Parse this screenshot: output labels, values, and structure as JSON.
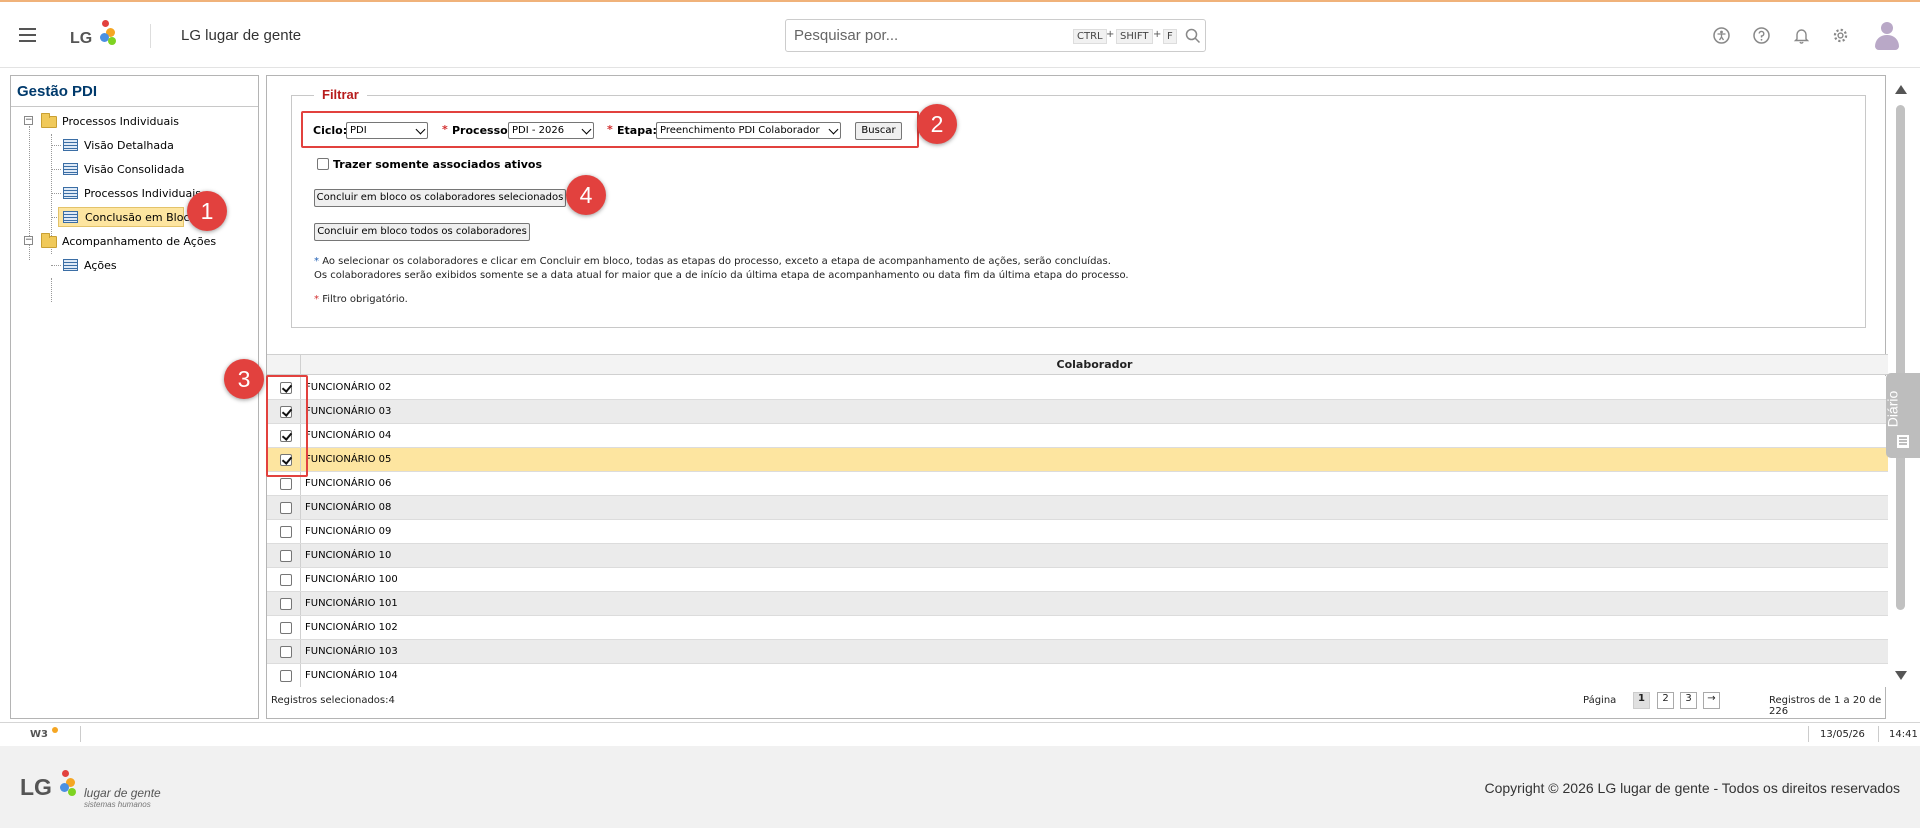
{
  "header": {
    "app_title": "LG lugar de gente",
    "search_placeholder": "Pesquisar por...",
    "shortcut_keys": [
      "CTRL",
      "SHIFT",
      "F"
    ],
    "shortcut_sep": "+"
  },
  "logo_text": "LG",
  "tree": {
    "title": "Gestão PDI",
    "groups": [
      {
        "label": "Processos Individuais",
        "children": [
          "Visão Detalhada",
          "Visão Consolidada",
          "Processos Individuais",
          "Conclusão em Bloco"
        ]
      },
      {
        "label": "Acompanhamento de Ações",
        "children": [
          "Ações"
        ]
      }
    ],
    "selected": "Conclusão em Bloco",
    "expander_glyph": "−"
  },
  "filter": {
    "legend": "Filtrar",
    "required_mark": "*",
    "ciclo_label": "Ciclo:",
    "ciclo_value": "PDI",
    "processo_label": "Processo:",
    "processo_value": "PDI - 2026",
    "etapa_label": "Etapa:",
    "etapa_value": "Preenchimento PDI Colaborador",
    "buscar_label": "Buscar",
    "ativos_label": "Trazer somente associados ativos",
    "ativos_checked": false,
    "btn_selecionados": "Concluir em bloco os colaboradores selecionados",
    "btn_todos": "Concluir em bloco todos os colaboradores",
    "note1": "Ao selecionar os colaboradores e clicar em Concluir em bloco, todas as etapas do processo, exceto a etapa de acompanhamento de ações, serão concluídas.",
    "note2": "Os colaboradores serão exibidos somente se a data atual for maior que a de início da última etapa de acompanhamento ou data fim da última etapa do processo.",
    "note3": "Filtro obrigatório."
  },
  "grid": {
    "column_header": "Colaborador",
    "rows": [
      {
        "name": "FUNCIONÁRIO 02",
        "checked": true
      },
      {
        "name": "FUNCIONÁRIO 03",
        "checked": true
      },
      {
        "name": "FUNCIONÁRIO 04",
        "checked": true
      },
      {
        "name": "FUNCIONÁRIO 05",
        "checked": true,
        "highlight": true
      },
      {
        "name": "FUNCIONÁRIO 06",
        "checked": false
      },
      {
        "name": "FUNCIONÁRIO 08",
        "checked": false
      },
      {
        "name": "FUNCIONÁRIO 09",
        "checked": false
      },
      {
        "name": "FUNCIONÁRIO 10",
        "checked": false
      },
      {
        "name": "FUNCIONÁRIO 100",
        "checked": false
      },
      {
        "name": "FUNCIONÁRIO 101",
        "checked": false
      },
      {
        "name": "FUNCIONÁRIO 102",
        "checked": false
      },
      {
        "name": "FUNCIONÁRIO 103",
        "checked": false
      },
      {
        "name": "FUNCIONÁRIO 104",
        "checked": false
      }
    ],
    "selected_count_label": "Registros selecionados:4",
    "page_label": "Página",
    "pages": [
      "1",
      "2",
      "3"
    ],
    "current_page": "1",
    "next_glyph": "→",
    "records_label": "Registros de 1 a 20 de 226"
  },
  "annotations": [
    "1",
    "2",
    "3",
    "4"
  ],
  "side_tab": "Diário",
  "statusbar": {
    "brand": "W3",
    "date": "13/05/26",
    "time": "14:41"
  },
  "footer": {
    "logo": "LG",
    "line1": "lugar de gente",
    "line2": "sistemas humanos",
    "copyright": "Copyright © 2026 LG lugar de gente - Todos os direitos reservados"
  },
  "colors": {
    "accent_red": "#e2413e",
    "highlight_row": "#fde5a0",
    "title_blue": "#003a6c",
    "legend_red": "#b71c1c"
  }
}
